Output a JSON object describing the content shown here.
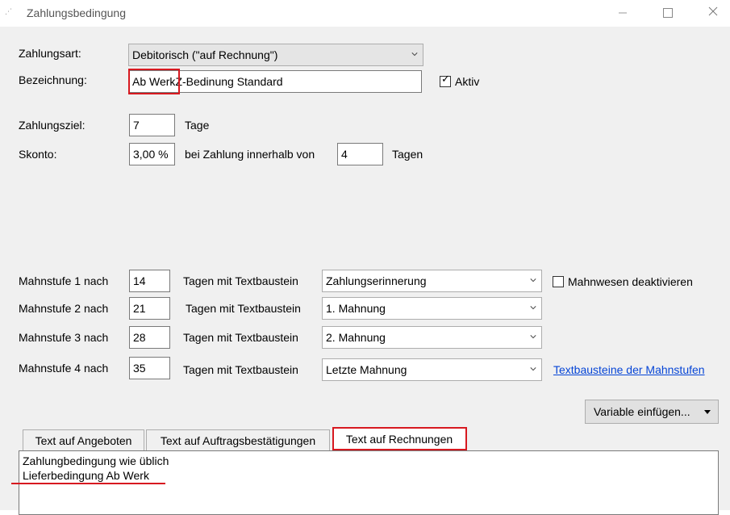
{
  "window": {
    "title": "Zahlungsbedingung"
  },
  "form": {
    "zahlungsart_label": "Zahlungsart:",
    "zahlungsart_value": "Debitorisch (\"auf Rechnung\")",
    "bezeichnung_label": "Bezeichnung:",
    "bezeichnung_value_prefix": "Ab Werk",
    "bezeichnung_value_rest": "Z-Bedinung Standard",
    "aktiv_label": "Aktiv",
    "aktiv_checked": true,
    "zahlungsziel_label": "Zahlungsziel:",
    "zahlungsziel_value": "7",
    "zahlungsziel_unit": "Tage",
    "skonto_label": "Skonto:",
    "skonto_value": "3,00 %",
    "skonto_mid": "bei Zahlung innerhalb von",
    "skonto_days": "4",
    "skonto_unit": "Tagen"
  },
  "mahnstufen": [
    {
      "label": "Mahnstufe 1 nach",
      "days": "14",
      "mid": "Tagen mit Textbaustein",
      "textbaustein": "Zahlungserinnerung"
    },
    {
      "label": "Mahnstufe 2 nach",
      "days": "21",
      "mid": "Tagen mit Textbaustein",
      "textbaustein": "1. Mahnung"
    },
    {
      "label": "Mahnstufe 3 nach",
      "days": "28",
      "mid": "Tagen mit Textbaustein",
      "textbaustein": "2. Mahnung"
    },
    {
      "label": "Mahnstufe 4 nach",
      "days": "35",
      "mid": "Tagen mit Textbaustein",
      "textbaustein": "Letzte Mahnung"
    }
  ],
  "mahnwesen_deaktivieren_label": "Mahnwesen deaktivieren",
  "mahnwesen_deaktivieren_checked": false,
  "textbausteine_link": "Textbausteine der Mahnstufen",
  "variable_button": "Variable einfügen...",
  "tabs": [
    {
      "label": "Text auf Angeboten"
    },
    {
      "label": "Text auf Auftragsbestätigungen"
    },
    {
      "label": "Text auf Rechnungen"
    }
  ],
  "active_tab": 2,
  "text_content": {
    "line1": "Zahlungbedingung wie üblich",
    "line2": "Lieferbedingung Ab Werk"
  },
  "colors": {
    "highlight": "#d71920",
    "link": "#0645d6",
    "dialog_bg": "#f0f0f0"
  }
}
